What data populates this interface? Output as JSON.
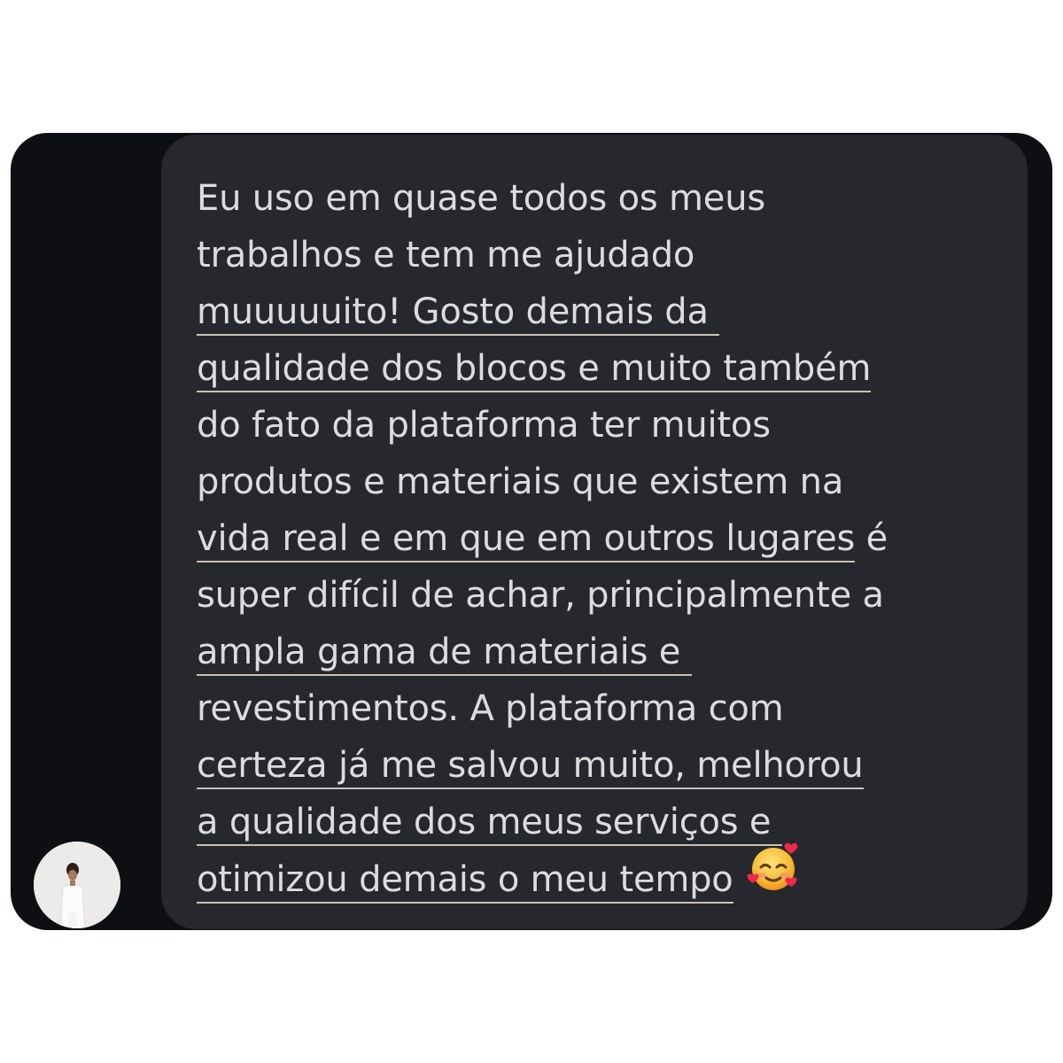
{
  "message": {
    "lines": [
      {
        "text": "Eu uso em quase todos os meus",
        "tail": ""
      },
      {
        "text": "trabalhos e tem me ajudado",
        "tail": ""
      },
      {
        "text": "muuuuuito! Gosto demais da ",
        "tail": ""
      },
      {
        "text": "qualidade dos blocos e muito também",
        "tail": ""
      },
      {
        "text": "do fato da plataforma ter muitos",
        "tail": ""
      },
      {
        "text": "produtos e materiais que existem na",
        "tail": ""
      },
      {
        "text": "vida real e em que em outros lugares",
        "tail": " é"
      },
      {
        "text": "super difícil de achar, principalmente a",
        "tail": ""
      },
      {
        "text": "ampla gama de materiais e ",
        "tail": ""
      },
      {
        "text": "revestimentos. A plataforma com",
        "tail": ""
      },
      {
        "text": "certeza já me salvou muito, melhorou",
        "tail": ""
      },
      {
        "text": "a qualidade dos meus serviços e ",
        "tail": ""
      },
      {
        "text": "otimizou demais o meu tempo",
        "tail": ""
      }
    ],
    "emoji": "smiling-face-with-hearts-icon"
  },
  "avatar": {
    "icon": "user-avatar"
  },
  "colors": {
    "page_background": "#ffffff",
    "frame_background": "#0d0f13",
    "bubble_background": "#26282d",
    "text": "#dcdcdf",
    "underline": "#c9c2b1"
  }
}
